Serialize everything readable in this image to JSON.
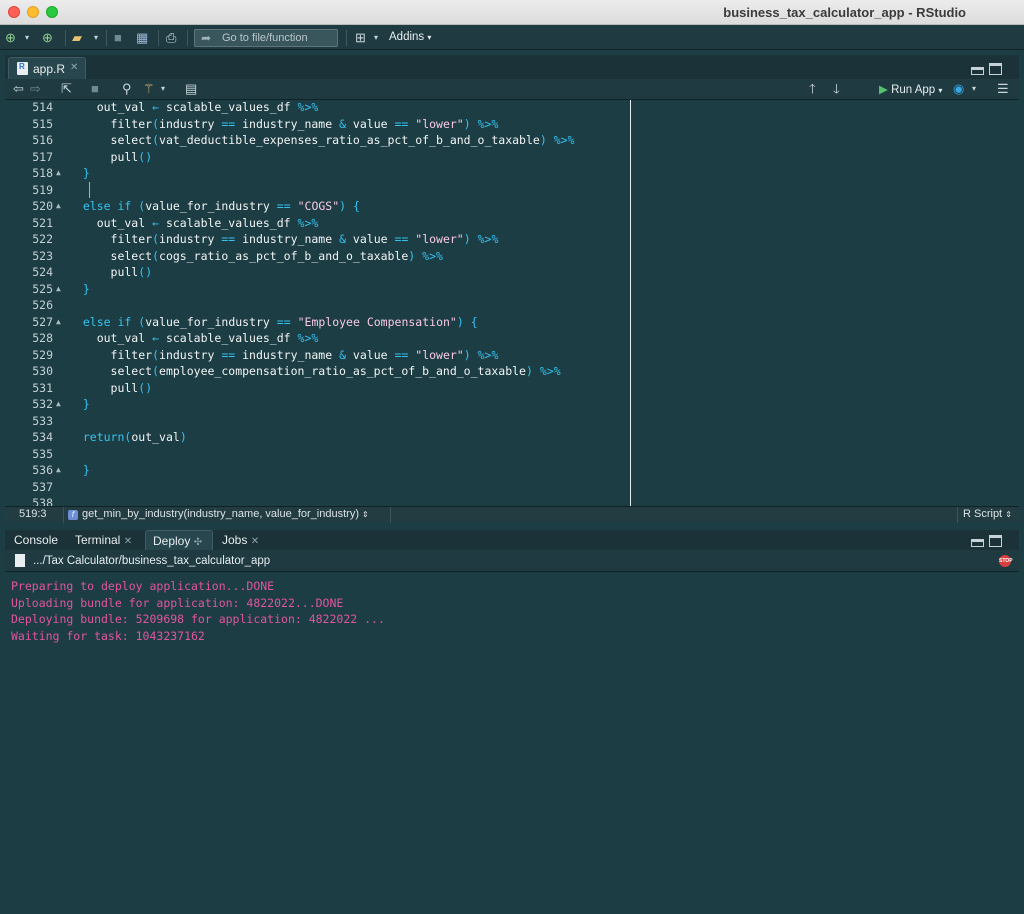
{
  "window": {
    "title": "business_tax_calculator_app - RStudio"
  },
  "toolbar": {
    "goto_placeholder": "Go to file/function",
    "addins_label": "Addins"
  },
  "editor": {
    "tab_label": "app.R",
    "run_app_label": "Run App",
    "lines": [
      {
        "n": "514",
        "fold": false,
        "code": "  out_val <- scalable_values_df %>%"
      },
      {
        "n": "515",
        "fold": false,
        "code": "    filter(industry == industry_name & value == \"lower\") %>%"
      },
      {
        "n": "516",
        "fold": false,
        "code": "    select(vat_deductible_expenses_ratio_as_pct_of_b_and_o_taxable) %>%"
      },
      {
        "n": "517",
        "fold": false,
        "code": "    pull()"
      },
      {
        "n": "518",
        "fold": true,
        "code": "}"
      },
      {
        "n": "519",
        "fold": false,
        "code": ""
      },
      {
        "n": "520",
        "fold": true,
        "code": "else if (value_for_industry == \"COGS\") {"
      },
      {
        "n": "521",
        "fold": false,
        "code": "  out_val <- scalable_values_df %>%"
      },
      {
        "n": "522",
        "fold": false,
        "code": "    filter(industry == industry_name & value == \"lower\") %>%"
      },
      {
        "n": "523",
        "fold": false,
        "code": "    select(cogs_ratio_as_pct_of_b_and_o_taxable) %>%"
      },
      {
        "n": "524",
        "fold": false,
        "code": "    pull()"
      },
      {
        "n": "525",
        "fold": true,
        "code": "}"
      },
      {
        "n": "526",
        "fold": false,
        "code": ""
      },
      {
        "n": "527",
        "fold": true,
        "code": "else if (value_for_industry == \"Employee Compensation\") {"
      },
      {
        "n": "528",
        "fold": false,
        "code": "  out_val <- scalable_values_df %>%"
      },
      {
        "n": "529",
        "fold": false,
        "code": "    filter(industry == industry_name & value == \"lower\") %>%"
      },
      {
        "n": "530",
        "fold": false,
        "code": "    select(employee_compensation_ratio_as_pct_of_b_and_o_taxable) %>%"
      },
      {
        "n": "531",
        "fold": false,
        "code": "    pull()"
      },
      {
        "n": "532",
        "fold": true,
        "code": "}"
      },
      {
        "n": "533",
        "fold": false,
        "code": ""
      },
      {
        "n": "534",
        "fold": false,
        "code": "return(out_val)"
      },
      {
        "n": "535",
        "fold": false,
        "code": ""
      },
      {
        "n": "536",
        "fold": true,
        "code": "}"
      },
      {
        "n": "537",
        "fold": false,
        "code": ""
      },
      {
        "n": "538",
        "fold": false,
        "code": ""
      }
    ]
  },
  "status": {
    "position": "519:3",
    "function": "get_min_by_industry(industry_name, value_for_industry)",
    "file_type": "R Script"
  },
  "console": {
    "tabs": [
      {
        "label": "Console",
        "closable": false
      },
      {
        "label": "Terminal",
        "closable": true
      },
      {
        "label": "Deploy",
        "closable": false
      },
      {
        "label": "Jobs",
        "closable": true
      }
    ],
    "active_tab": "Deploy",
    "path": ".../Tax Calculator/business_tax_calculator_app",
    "stop_label": "STOP",
    "output": [
      "Preparing to deploy application...DONE",
      "Uploading bundle for application: 4822022...DONE",
      "Deploying bundle: 5209698 for application: 4822022 ...",
      "Waiting for task: 1043237162"
    ]
  },
  "colors": {
    "background": "#1d3d44",
    "keyword": "#35c2f0",
    "string": "#f8c9e4",
    "console_text": "#e0559f"
  }
}
